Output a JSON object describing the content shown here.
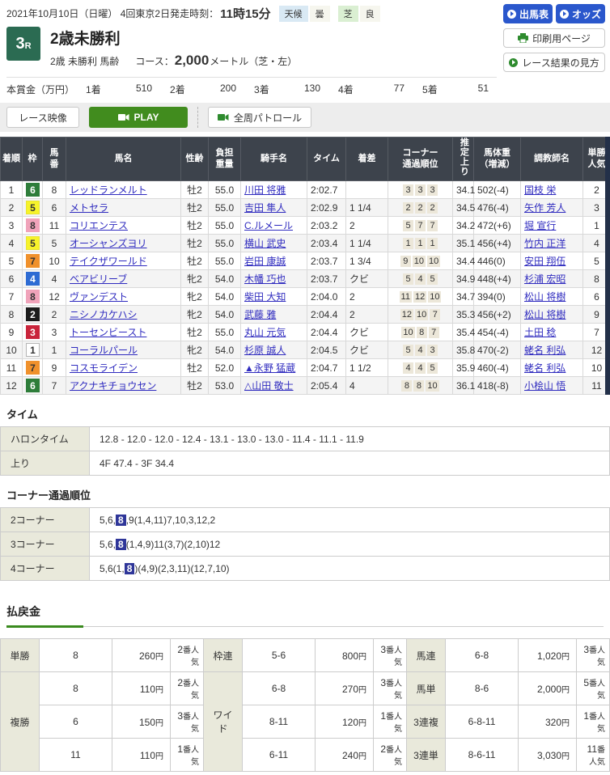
{
  "header": {
    "date_line": "2021年10月10日（日曜）  4回東京2日  ",
    "start_label": "発走時刻：",
    "start_time": "11時15分",
    "weather_label": "天候",
    "weather_value": "曇",
    "turf_label": "芝",
    "turf_value": "良",
    "btn_entries": "出馬表",
    "btn_odds": "オッズ",
    "btn_print": "印刷用ページ",
    "btn_guide": "レース結果の見方"
  },
  "race": {
    "number": "3",
    "number_suffix": "R",
    "title": "2歳未勝利",
    "conditions": "2歳 未勝利 馬齢",
    "course_label": "コース：",
    "course_value": "2,000",
    "course_unit": "メートル（芝・左）",
    "prize_label": "本賞金（万円）",
    "prizes": [
      {
        "place": "1着",
        "amount": "510"
      },
      {
        "place": "2着",
        "amount": "200"
      },
      {
        "place": "3着",
        "amount": "130"
      },
      {
        "place": "4着",
        "amount": "77"
      },
      {
        "place": "5着",
        "amount": "51"
      }
    ]
  },
  "video": {
    "race_video": "レース映像",
    "play": "PLAY",
    "patrol": "全周パトロール"
  },
  "results": {
    "headers": [
      "着順",
      "枠",
      "馬\n番",
      "馬名",
      "性齢",
      "負担\n重量",
      "騎手名",
      "タイム",
      "着差",
      "コーナー\n通過順位",
      "推定上り",
      "馬体重\n（増減）",
      "調教師名",
      "単勝\n人気"
    ],
    "frame_colors": {
      "1": {
        "bg": "#ffffff",
        "fg": "#333333",
        "border": "#b5b5b5"
      },
      "2": {
        "bg": "#1c1c1c",
        "fg": "#ffffff",
        "border": "#1c1c1c"
      },
      "3": {
        "bg": "#c9243b",
        "fg": "#ffffff",
        "border": "#c9243b"
      },
      "4": {
        "bg": "#2e6bd3",
        "fg": "#ffffff",
        "border": "#2e6bd3"
      },
      "5": {
        "bg": "#f7f32a",
        "fg": "#333333",
        "border": "#e8e432"
      },
      "6": {
        "bg": "#2e7d3a",
        "fg": "#ffffff",
        "border": "#2e7d3a"
      },
      "7": {
        "bg": "#f0912c",
        "fg": "#333333",
        "border": "#f0912c"
      },
      "8": {
        "bg": "#f0a3ba",
        "fg": "#333333",
        "border": "#f0a3ba"
      }
    },
    "rows": [
      {
        "finish": "1",
        "frame": "6",
        "horse_no": "8",
        "horse": "レッドランメルト",
        "sex_age": "牡2",
        "weight": "55.0",
        "jockey": "川田 将雅",
        "time": "2:02.7",
        "margin": "",
        "corners": [
          "3",
          "3",
          "3"
        ],
        "last3f": "34.1",
        "horse_weight": "502(-4)",
        "trainer": "国枝 栄",
        "fav": "2"
      },
      {
        "finish": "2",
        "frame": "5",
        "horse_no": "6",
        "horse": "メトセラ",
        "sex_age": "牡2",
        "weight": "55.0",
        "jockey": "吉田 隼人",
        "time": "2:02.9",
        "margin": "1 1/4",
        "corners": [
          "2",
          "2",
          "2"
        ],
        "last3f": "34.5",
        "horse_weight": "476(-4)",
        "trainer": "矢作 芳人",
        "fav": "3"
      },
      {
        "finish": "3",
        "frame": "8",
        "horse_no": "11",
        "horse": "コリエンテス",
        "sex_age": "牡2",
        "weight": "55.0",
        "jockey": "C.ルメール",
        "time": "2:03.2",
        "margin": "2",
        "corners": [
          "5",
          "7",
          "7"
        ],
        "last3f": "34.2",
        "horse_weight": "472(+6)",
        "trainer": "堀 宣行",
        "fav": "1"
      },
      {
        "finish": "4",
        "frame": "5",
        "horse_no": "5",
        "horse": "オーシャンズヨリ",
        "sex_age": "牡2",
        "weight": "55.0",
        "jockey": "横山 武史",
        "time": "2:03.4",
        "margin": "1 1/4",
        "corners": [
          "1",
          "1",
          "1"
        ],
        "last3f": "35.1",
        "horse_weight": "456(+4)",
        "trainer": "竹内 正洋",
        "fav": "4"
      },
      {
        "finish": "5",
        "frame": "7",
        "horse_no": "10",
        "horse": "テイクザワールド",
        "sex_age": "牡2",
        "weight": "55.0",
        "jockey": "岩田 康誠",
        "time": "2:03.7",
        "margin": "1 3/4",
        "corners": [
          "9",
          "10",
          "10"
        ],
        "last3f": "34.4",
        "horse_weight": "446(0)",
        "trainer": "安田 翔伍",
        "fav": "5"
      },
      {
        "finish": "6",
        "frame": "4",
        "horse_no": "4",
        "horse": "ベアビリーブ",
        "sex_age": "牝2",
        "weight": "54.0",
        "jockey": "木幡 巧也",
        "time": "2:03.7",
        "margin": "クビ",
        "corners": [
          "5",
          "4",
          "5"
        ],
        "last3f": "34.9",
        "horse_weight": "448(+4)",
        "trainer": "杉浦 宏昭",
        "fav": "8"
      },
      {
        "finish": "7",
        "frame": "8",
        "horse_no": "12",
        "horse": "ヴァンデスト",
        "sex_age": "牝2",
        "weight": "54.0",
        "jockey": "柴田 大知",
        "time": "2:04.0",
        "margin": "2",
        "corners": [
          "11",
          "12",
          "10"
        ],
        "last3f": "34.7",
        "horse_weight": "394(0)",
        "trainer": "松山 将樹",
        "fav": "6"
      },
      {
        "finish": "8",
        "frame": "2",
        "horse_no": "2",
        "horse": "ニシノカケハシ",
        "sex_age": "牝2",
        "weight": "54.0",
        "jockey": "武藤 雅",
        "time": "2:04.4",
        "margin": "2",
        "corners": [
          "12",
          "10",
          "7"
        ],
        "last3f": "35.3",
        "horse_weight": "456(+2)",
        "trainer": "松山 将樹",
        "fav": "9"
      },
      {
        "finish": "9",
        "frame": "3",
        "horse_no": "3",
        "horse": "トーセンビースト",
        "sex_age": "牡2",
        "weight": "55.0",
        "jockey": "丸山 元気",
        "time": "2:04.4",
        "margin": "クビ",
        "corners": [
          "10",
          "8",
          "7"
        ],
        "last3f": "35.4",
        "horse_weight": "454(-4)",
        "trainer": "土田 稔",
        "fav": "7"
      },
      {
        "finish": "10",
        "frame": "1",
        "horse_no": "1",
        "horse": "コーラルパール",
        "sex_age": "牝2",
        "weight": "54.0",
        "jockey": "杉原 誠人",
        "time": "2:04.5",
        "margin": "クビ",
        "corners": [
          "5",
          "4",
          "3"
        ],
        "last3f": "35.8",
        "horse_weight": "470(-2)",
        "trainer": "蛯名 利弘",
        "fav": "12"
      },
      {
        "finish": "11",
        "frame": "7",
        "horse_no": "9",
        "horse": "コスモライデン",
        "sex_age": "牡2",
        "weight": "52.0",
        "jockey": "▲永野 猛蔵",
        "time": "2:04.7",
        "margin": "1 1/2",
        "corners": [
          "4",
          "4",
          "5"
        ],
        "last3f": "35.9",
        "horse_weight": "460(-4)",
        "trainer": "蛯名 利弘",
        "fav": "10"
      },
      {
        "finish": "12",
        "frame": "6",
        "horse_no": "7",
        "horse": "アクナキチョウセン",
        "sex_age": "牡2",
        "weight": "53.0",
        "jockey": "△山田 敬士",
        "time": "2:05.4",
        "margin": "4",
        "corners": [
          "8",
          "8",
          "10"
        ],
        "last3f": "36.1",
        "horse_weight": "418(-8)",
        "trainer": "小桧山 悟",
        "fav": "11"
      }
    ]
  },
  "time_section": {
    "title": "タイム",
    "rows": [
      {
        "label": "ハロンタイム",
        "value": "12.8 - 12.0 - 12.0 - 12.4 - 13.1 - 13.0 - 13.0 - 11.4 - 11.1 - 11.9"
      },
      {
        "label": "上り",
        "value": "4F 47.4 - 3F 34.4"
      }
    ]
  },
  "corner_section": {
    "title": "コーナー通過順位",
    "rows": [
      {
        "label": "2コーナー",
        "before": "5,6,",
        "highlight": "8",
        "after": ",9(1,4,11)7,10,3,12,2"
      },
      {
        "label": "3コーナー",
        "before": "5,6,",
        "highlight": "8",
        "after": "(1,4,9)11(3,7)(2,10)12"
      },
      {
        "label": "4コーナー",
        "before": "5,6(1,",
        "highlight": "8",
        "after": ")(4,9)(2,3,11)(12,7,10)"
      }
    ]
  },
  "payouts": {
    "title": "払戻金",
    "yen": "円",
    "ninki": "番人気",
    "bet_types": {
      "tansho": "単勝",
      "fukusho": "複勝",
      "wakuren": "枠連",
      "wide": "ワイド",
      "umaren": "馬連",
      "umatan": "馬単",
      "sanrenpuku": "3連複",
      "sanrentan": "3連単"
    },
    "cells": {
      "tansho": {
        "sel": "8",
        "pay": "260",
        "fav": "2"
      },
      "fukusho": [
        {
          "sel": "8",
          "pay": "110",
          "fav": "2"
        },
        {
          "sel": "6",
          "pay": "150",
          "fav": "3"
        },
        {
          "sel": "11",
          "pay": "110",
          "fav": "1"
        }
      ],
      "wakuren": {
        "sel": "5-6",
        "pay": "800",
        "fav": "3"
      },
      "wide": [
        {
          "sel": "6-8",
          "pay": "270",
          "fav": "3"
        },
        {
          "sel": "8-11",
          "pay": "120",
          "fav": "1"
        },
        {
          "sel": "6-11",
          "pay": "240",
          "fav": "2"
        }
      ],
      "umaren": {
        "sel": "6-8",
        "pay": "1,020",
        "fav": "3"
      },
      "umatan": {
        "sel": "8-6",
        "pay": "2,000",
        "fav": "5"
      },
      "sanrenpuku": {
        "sel": "6-8-11",
        "pay": "320",
        "fav": "1"
      },
      "sanrentan": {
        "sel": "8-6-11",
        "pay": "3,030",
        "fav": "11"
      }
    }
  }
}
